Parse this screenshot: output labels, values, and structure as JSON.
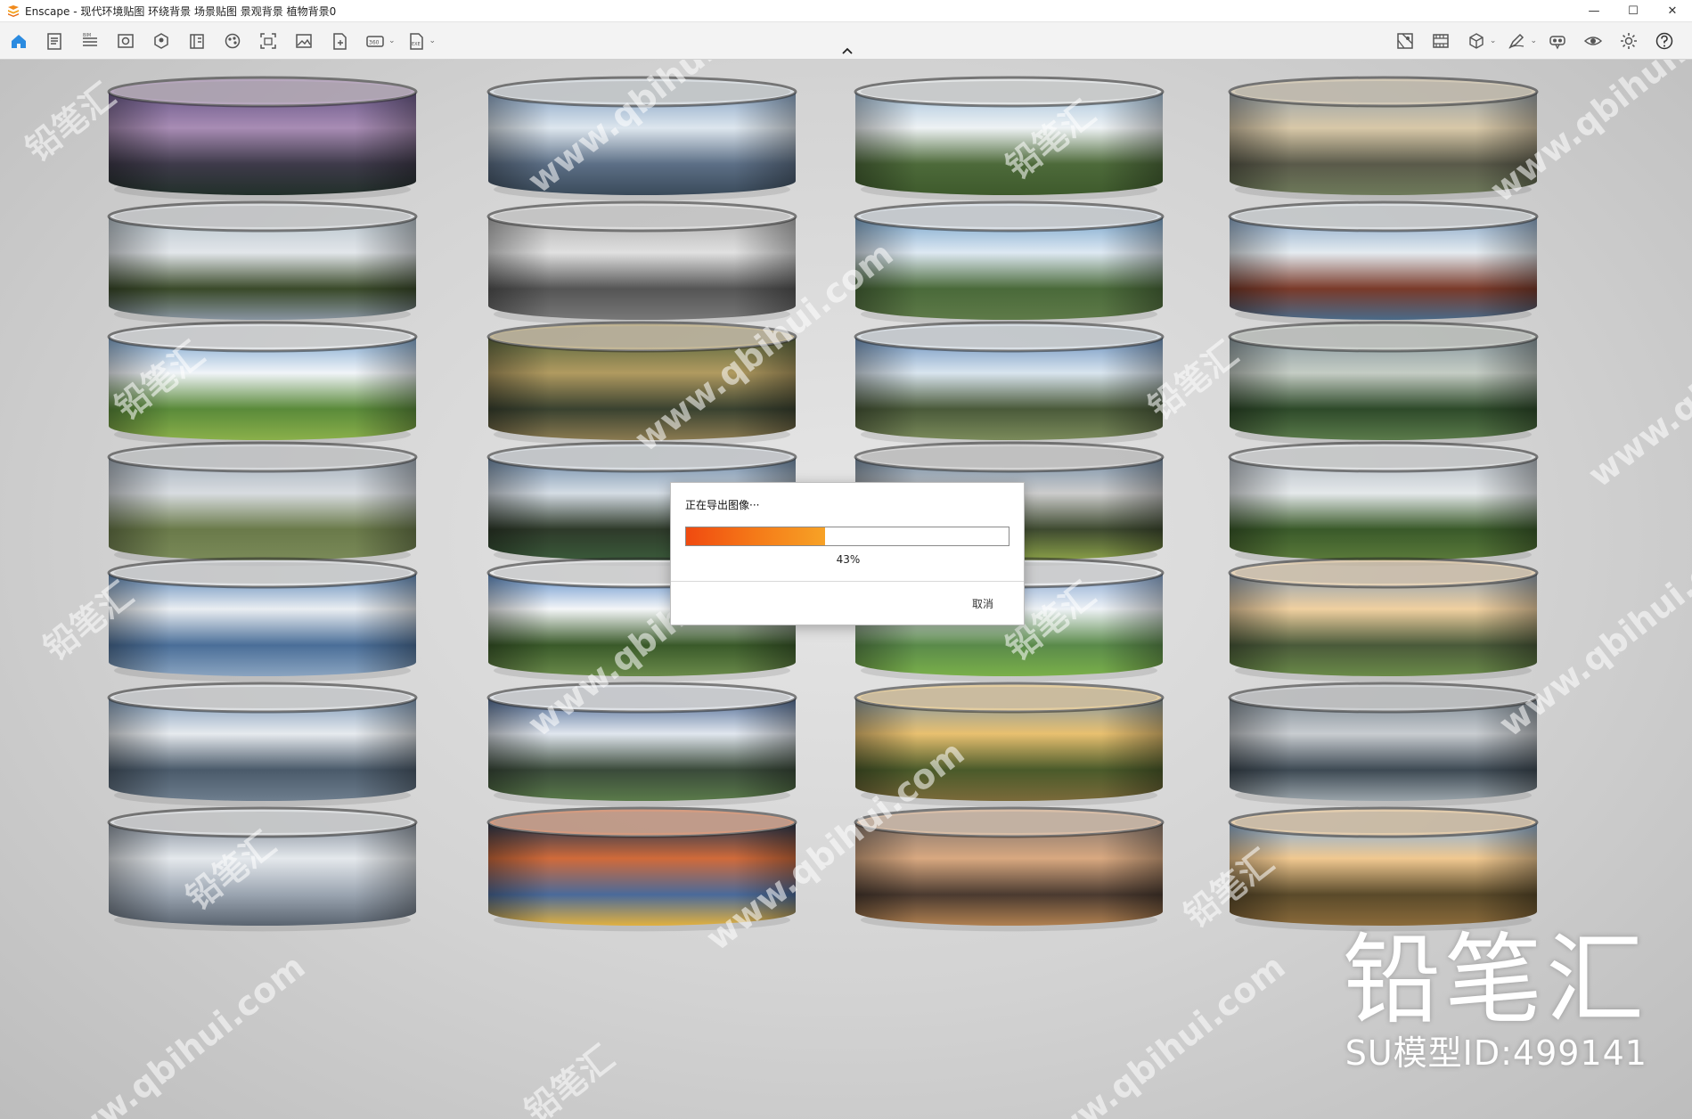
{
  "window": {
    "title": "Enscape - 现代环境贴图 环绕背景  场景贴图 景观背景 植物背景0",
    "minimize": "—",
    "maximize": "☐",
    "close": "✕"
  },
  "toolbar": {
    "left": [
      {
        "name": "home-icon",
        "caret": false
      },
      {
        "name": "document-icon",
        "caret": false
      },
      {
        "name": "bim-icon",
        "caret": false,
        "label": "BIM"
      },
      {
        "name": "view-icon",
        "caret": false
      },
      {
        "name": "object-icon",
        "caret": false
      },
      {
        "name": "library-icon",
        "caret": false
      },
      {
        "name": "material-icon",
        "caret": false
      },
      {
        "name": "screenshot-icon",
        "caret": false
      },
      {
        "name": "image-icon",
        "caret": false
      },
      {
        "name": "export-file-icon",
        "caret": false
      },
      {
        "name": "panorama-360-icon",
        "caret": true,
        "label": "360"
      },
      {
        "name": "export-exe-icon",
        "caret": true,
        "label": "EXE"
      }
    ],
    "right": [
      {
        "name": "map-icon",
        "caret": false
      },
      {
        "name": "film-icon",
        "caret": false
      },
      {
        "name": "cube-icon",
        "caret": true
      },
      {
        "name": "pen-icon",
        "caret": true
      },
      {
        "name": "vr-headset-icon",
        "caret": false
      },
      {
        "name": "eye-icon",
        "caret": false
      },
      {
        "name": "settings-gear-icon",
        "caret": false
      },
      {
        "name": "help-icon",
        "caret": false
      }
    ]
  },
  "dialog": {
    "title": "正在导出图像···",
    "progress": 0.43,
    "percent_label": "43%",
    "cancel_label": "取消"
  },
  "watermark": {
    "brand": "铅笔汇",
    "model_id": "SU模型ID:499141",
    "tile_texts": [
      "铅笔汇",
      "www.qbihui.com"
    ]
  },
  "palettes": [
    [
      "#6b5a8a",
      "#a88cb4",
      "#3e3a4a",
      "#22302a"
    ],
    [
      "#8aa6c6",
      "#dde6ee",
      "#5c6f86",
      "#3a4a5a"
    ],
    [
      "#a8c4dc",
      "#eef2f4",
      "#4d6a3a",
      "#3e5a2c"
    ],
    [
      "#9aa3a8",
      "#d8c8a8",
      "#5a5a4a",
      "#6e7a5a"
    ],
    [
      "#b8c4cc",
      "#e2e6ea",
      "#3a4a2a",
      "#8894a0"
    ],
    [
      "#b0b0b0",
      "#e0e0e0",
      "#555555",
      "#777777"
    ],
    [
      "#7aa6cc",
      "#dde8f2",
      "#4a6a3a",
      "#5e7a48"
    ],
    [
      "#8aa8c8",
      "#e4ebf0",
      "#7a3a2a",
      "#4a6a88"
    ],
    [
      "#80a8d0",
      "#f0f4f8",
      "#5a8a3a",
      "#8ab04a"
    ],
    [
      "#5e6a40",
      "#b09a60",
      "#3a4230",
      "#8a7a50"
    ],
    [
      "#6e94c0",
      "#d8e4ee",
      "#4a5a3a",
      "#7a8a5a"
    ],
    [
      "#8a9aa0",
      "#c4ccc4",
      "#2e4a2a",
      "#5a7a4a"
    ],
    [
      "#a4b0bc",
      "#d8dce0",
      "#6a7a4a",
      "#7a8a58"
    ],
    [
      "#6e8aa8",
      "#d4dce4",
      "#2e3a2a",
      "#3a5a3a"
    ],
    [
      "#7890a8",
      "#cccccc",
      "#3e4a30",
      "#8aa048"
    ],
    [
      "#b4bcc4",
      "#e4e8ea",
      "#3a5a2a",
      "#5a7a3a"
    ],
    [
      "#5e88b8",
      "#eaeef2",
      "#4a6e98",
      "#8aa4c0"
    ],
    [
      "#5c8cc8",
      "#f4f6f8",
      "#3a5a2a",
      "#6a8a4a"
    ],
    [
      "#86a6d0",
      "#eef2f6",
      "#5a8a4a",
      "#7ab04a"
    ],
    [
      "#90a0b0",
      "#f0d0a0",
      "#4a5a3a",
      "#6a8a48"
    ],
    [
      "#7e9ab8",
      "#e6eaee",
      "#4a5a6a",
      "#6e7e8e"
    ],
    [
      "#4e6a94",
      "#e0e6ee",
      "#3a4a3a",
      "#5a7a4a"
    ],
    [
      "#8a9aa0",
      "#e8c070",
      "#4a5a2a",
      "#7a6a3a"
    ],
    [
      "#7e8a94",
      "#c8ccd0",
      "#3e4a54",
      "#9aa4aa"
    ],
    [
      "#8a94a0",
      "#e4e8ec",
      "#9aa4b0",
      "#5a6470"
    ],
    [
      "#283850",
      "#d06a3a",
      "#4a6a9a",
      "#e0b040"
    ],
    [
      "#8a7a70",
      "#d8a880",
      "#4a3a30",
      "#b08050"
    ],
    [
      "#8ab0d8",
      "#f0c890",
      "#5a4a2a",
      "#8a6a3a"
    ]
  ]
}
